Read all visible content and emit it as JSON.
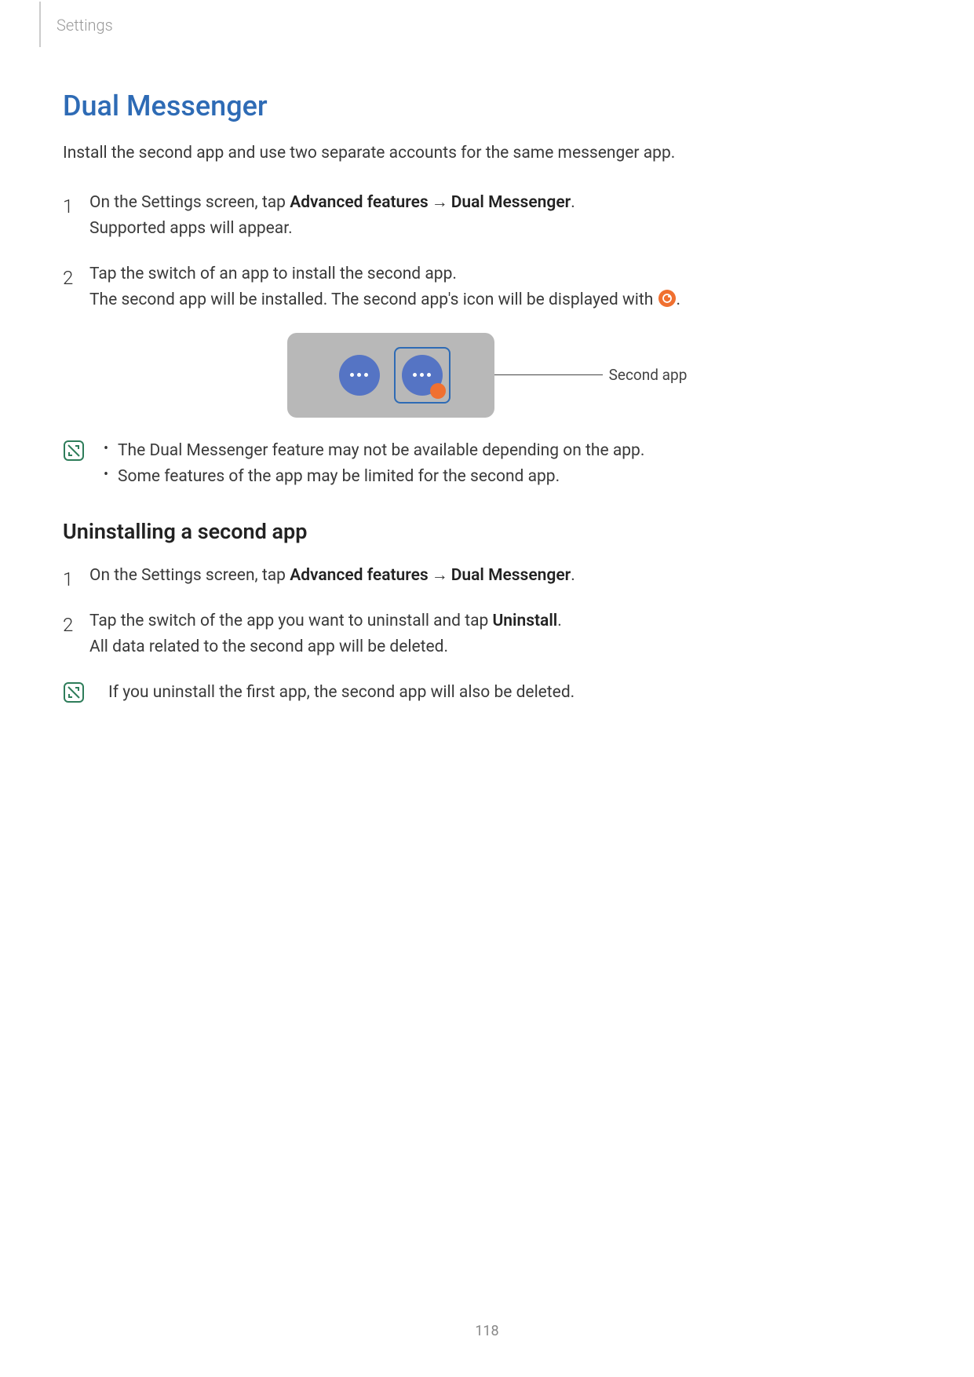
{
  "header": {
    "breadcrumb": "Settings"
  },
  "title": "Dual Messenger",
  "intro": "Install the second app and use two separate accounts for the same messenger app.",
  "steps1": {
    "s1_pre": "On the Settings screen, tap ",
    "s1_b1": "Advanced features",
    "s1_arrow": "→",
    "s1_b2": "Dual Messenger",
    "s1_post": ".",
    "s1_line2": "Supported apps will appear.",
    "s2_line1": "Tap the switch of an app to install the second app.",
    "s2_line2a": "The second app will be installed. The second app's icon will be displayed with ",
    "s2_line2b": "."
  },
  "figure": {
    "callout": "Second app"
  },
  "notes1": {
    "n1": "The Dual Messenger feature may not be available depending on the app.",
    "n2": "Some features of the app may be limited for the second app."
  },
  "subheading": "Uninstalling a second app",
  "steps2": {
    "s1_pre": "On the Settings screen, tap ",
    "s1_b1": "Advanced features",
    "s1_arrow": "→",
    "s1_b2": "Dual Messenger",
    "s1_post": ".",
    "s2_pre": "Tap the switch of the app you want to uninstall and tap ",
    "s2_b1": "Uninstall",
    "s2_post": ".",
    "s2_line2": "All data related to the second app will be deleted."
  },
  "note2": "If you uninstall the first app, the second app will also be deleted.",
  "pageNumber": "118"
}
